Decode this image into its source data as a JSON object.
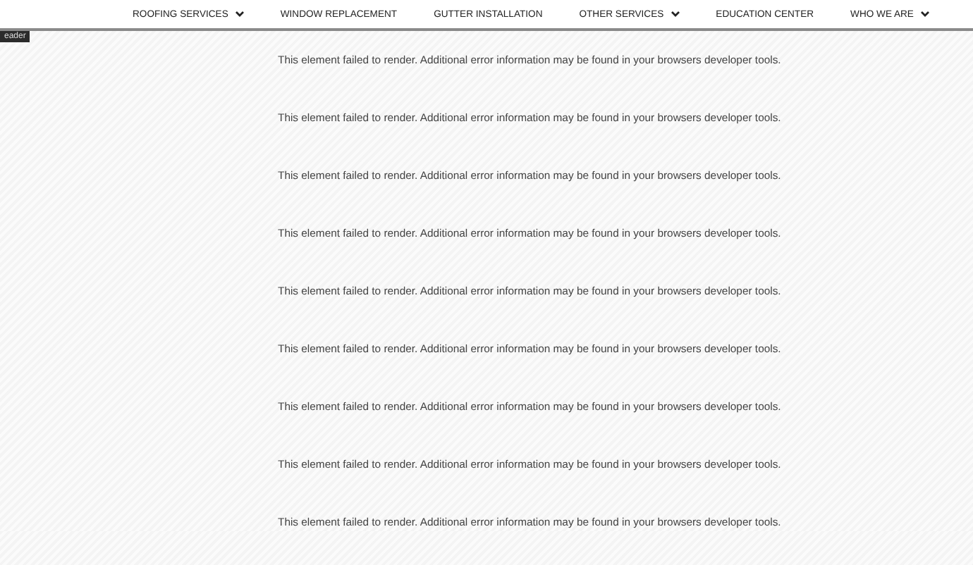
{
  "nav": [
    {
      "label": "ROOFING SERVICES",
      "has_dropdown": true
    },
    {
      "label": "WINDOW REPLACEMENT",
      "has_dropdown": false
    },
    {
      "label": "GUTTER INSTALLATION",
      "has_dropdown": false
    },
    {
      "label": "OTHER SERVICES",
      "has_dropdown": true
    },
    {
      "label": "EDUCATION CENTER",
      "has_dropdown": false
    },
    {
      "label": "WHO WE ARE",
      "has_dropdown": true
    }
  ],
  "section_tag": "eader",
  "errors": [
    "This element failed to render. Additional error information may be found in your browsers developer tools.",
    "This element failed to render. Additional error information may be found in your browsers developer tools.",
    "This element failed to render. Additional error information may be found in your browsers developer tools.",
    "This element failed to render. Additional error information may be found in your browsers developer tools.",
    "This element failed to render. Additional error information may be found in your browsers developer tools.",
    "This element failed to render. Additional error information may be found in your browsers developer tools.",
    "This element failed to render. Additional error information may be found in your browsers developer tools.",
    "This element failed to render. Additional error information may be found in your browsers developer tools.",
    "This element failed to render. Additional error information may be found in your browsers developer tools."
  ]
}
